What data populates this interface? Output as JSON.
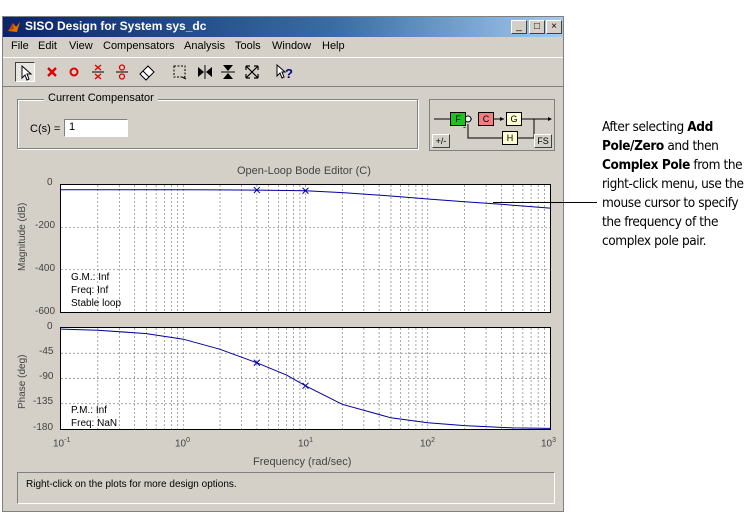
{
  "window": {
    "title": "SISO Design for System sys_dc",
    "controls": {
      "minimize": "_",
      "maximize": "□",
      "close": "×"
    }
  },
  "menubar": [
    "File",
    "Edit",
    "View",
    "Compensators",
    "Analysis",
    "Tools",
    "Window",
    "Help"
  ],
  "toolbar_icons": [
    "arrow-select-icon",
    "delete-pole-zero-icon",
    "add-zero-icon",
    "add-pole-pair-icon",
    "add-zero-pair-icon",
    "eraser-icon",
    "zoom-box-icon",
    "zoom-x-icon",
    "zoom-y-icon",
    "zoom-fit-icon",
    "whats-this-help-icon"
  ],
  "compensator": {
    "group_title": "Current Compensator",
    "label": "C(s) =",
    "value": "1"
  },
  "diagram": {
    "blocks": [
      "F",
      "C",
      "G",
      "H"
    ],
    "sign_button": "+/-",
    "fs_button": "FS",
    "sign": "-"
  },
  "bode": {
    "title": "Open-Loop Bode Editor (C)",
    "magnitude": {
      "ylabel": "Magnitude (dB)",
      "yticks": [
        "0",
        "-200",
        "-400",
        "-600"
      ],
      "notes": [
        "G.M.: Inf",
        "Freq: Inf",
        "Stable loop"
      ]
    },
    "phase": {
      "ylabel": "Phase (deg)",
      "yticks": [
        "0",
        "-45",
        "-90",
        "-135",
        "-180"
      ],
      "notes": [
        "P.M.: Inf",
        "Freq: NaN"
      ]
    },
    "xticks": [
      "10",
      "10",
      "10",
      "10",
      "10"
    ],
    "xtick_exps": [
      "-1",
      "0",
      "1",
      "2",
      "3"
    ],
    "xlabel": "Frequency (rad/sec)"
  },
  "status": "Right-click on the plots for more design options.",
  "callout": {
    "parts": [
      {
        "text": "After selecting ",
        "bold": false
      },
      {
        "text": "Add Pole/Zero",
        "bold": true
      },
      {
        "text": " and then ",
        "bold": false
      },
      {
        "text": "Complex Pole",
        "bold": true
      },
      {
        "text": " from the right-click menu, use the mouse cursor to specify the frequency of the complex pole pair.",
        "bold": false
      }
    ]
  },
  "colors": {
    "curve": "#0000a0",
    "grid": "#808080",
    "title_bar": "#0a246a"
  },
  "chart_data": [
    {
      "type": "line",
      "title": "Open-Loop Bode Editor (C)",
      "xlabel": "Frequency (rad/sec)",
      "ylabel": "Magnitude (dB)",
      "xscale": "log",
      "xlim": [
        0.1,
        1000
      ],
      "ylim": [
        -600,
        0
      ],
      "grid": true,
      "x": [
        0.1,
        0.3,
        1,
        2,
        4,
        7,
        10,
        20,
        50,
        100,
        200,
        400,
        1000
      ],
      "values": [
        -22,
        -22,
        -22,
        -23,
        -24,
        -26,
        -27,
        -36,
        -52,
        -66,
        -79,
        -91,
        -109
      ],
      "markers_x": [
        4,
        10
      ]
    },
    {
      "type": "line",
      "xlabel": "Frequency (rad/sec)",
      "ylabel": "Phase (deg)",
      "xscale": "log",
      "xlim": [
        0.1,
        1000
      ],
      "ylim": [
        -180,
        0
      ],
      "grid": true,
      "x": [
        0.1,
        0.2,
        0.5,
        1,
        2,
        4,
        7,
        10,
        20,
        50,
        100,
        200,
        500,
        1000
      ],
      "values": [
        -2,
        -4,
        -10,
        -20,
        -38,
        -62,
        -84,
        -103,
        -136,
        -160,
        -169,
        -174,
        -178,
        -179
      ],
      "markers_x": [
        4,
        10
      ]
    }
  ]
}
